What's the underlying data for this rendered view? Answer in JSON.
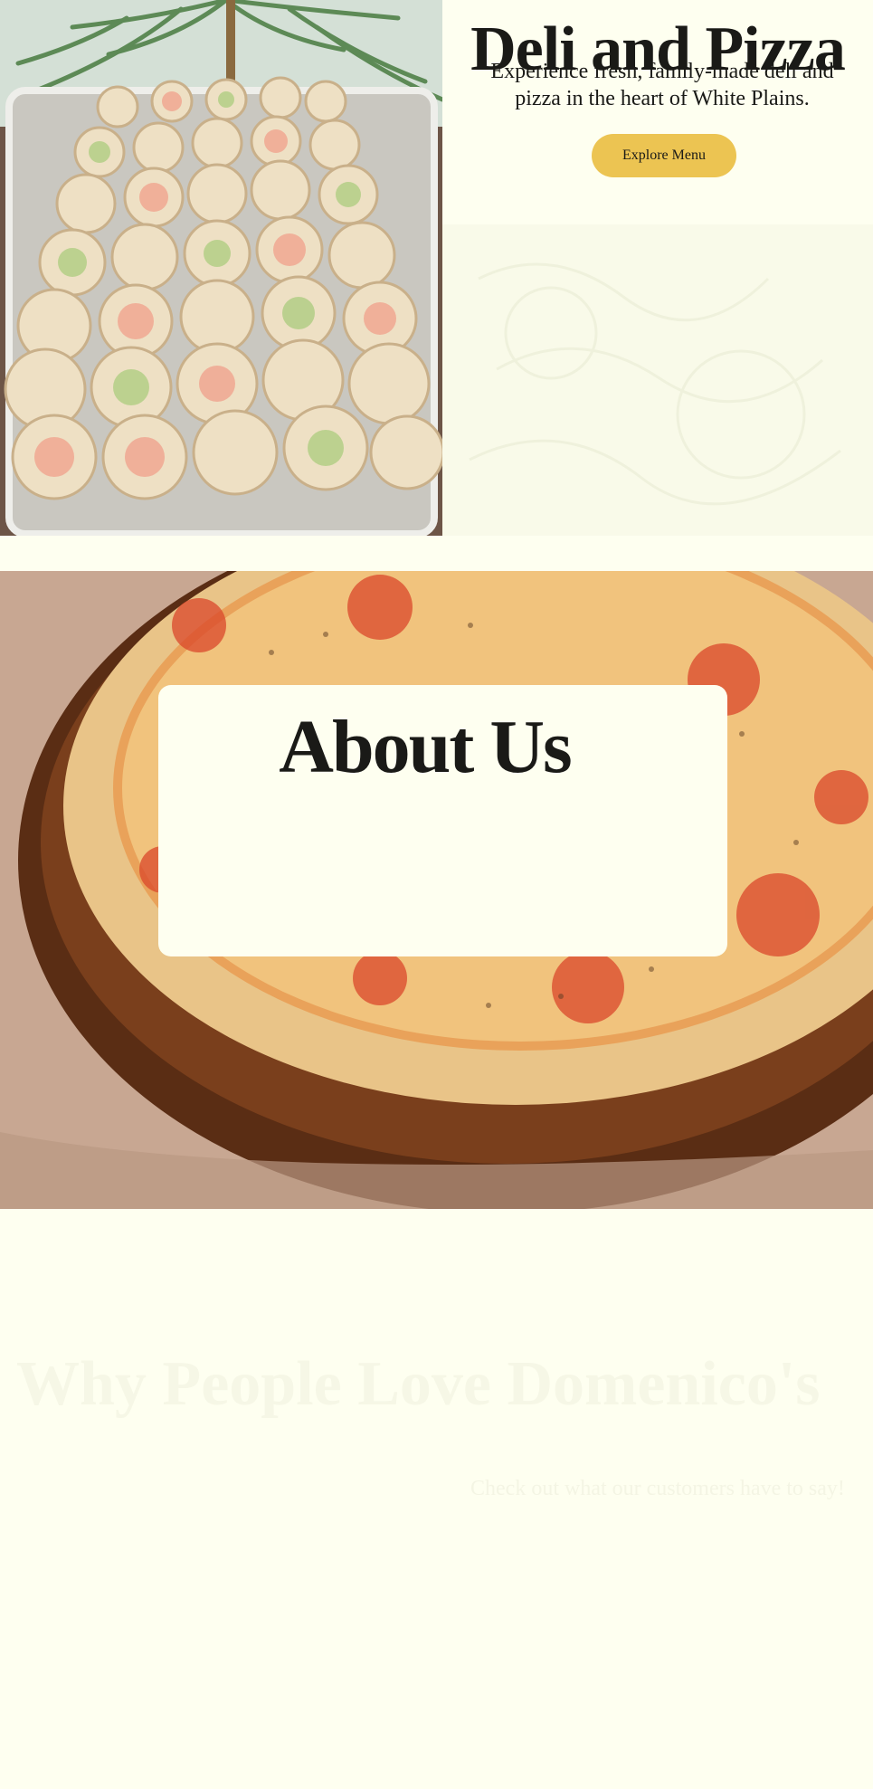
{
  "hero": {
    "title": "Deli and Pizza",
    "subtitle": "Experience fresh, family-made deli and pizza in the heart of White Plains.",
    "cta_label": "Explore Menu",
    "cta_color": "#ecc452",
    "image": "wraps-platter-photo"
  },
  "about": {
    "title": "About Us",
    "image": "pizza-on-board-photo"
  },
  "reviews": {
    "title": "Why People Love Domenico's",
    "intro": "Check out what our customers have to say!"
  },
  "colors": {
    "background": "#fefff0",
    "text": "#1a1a17",
    "accent": "#ecc452"
  }
}
